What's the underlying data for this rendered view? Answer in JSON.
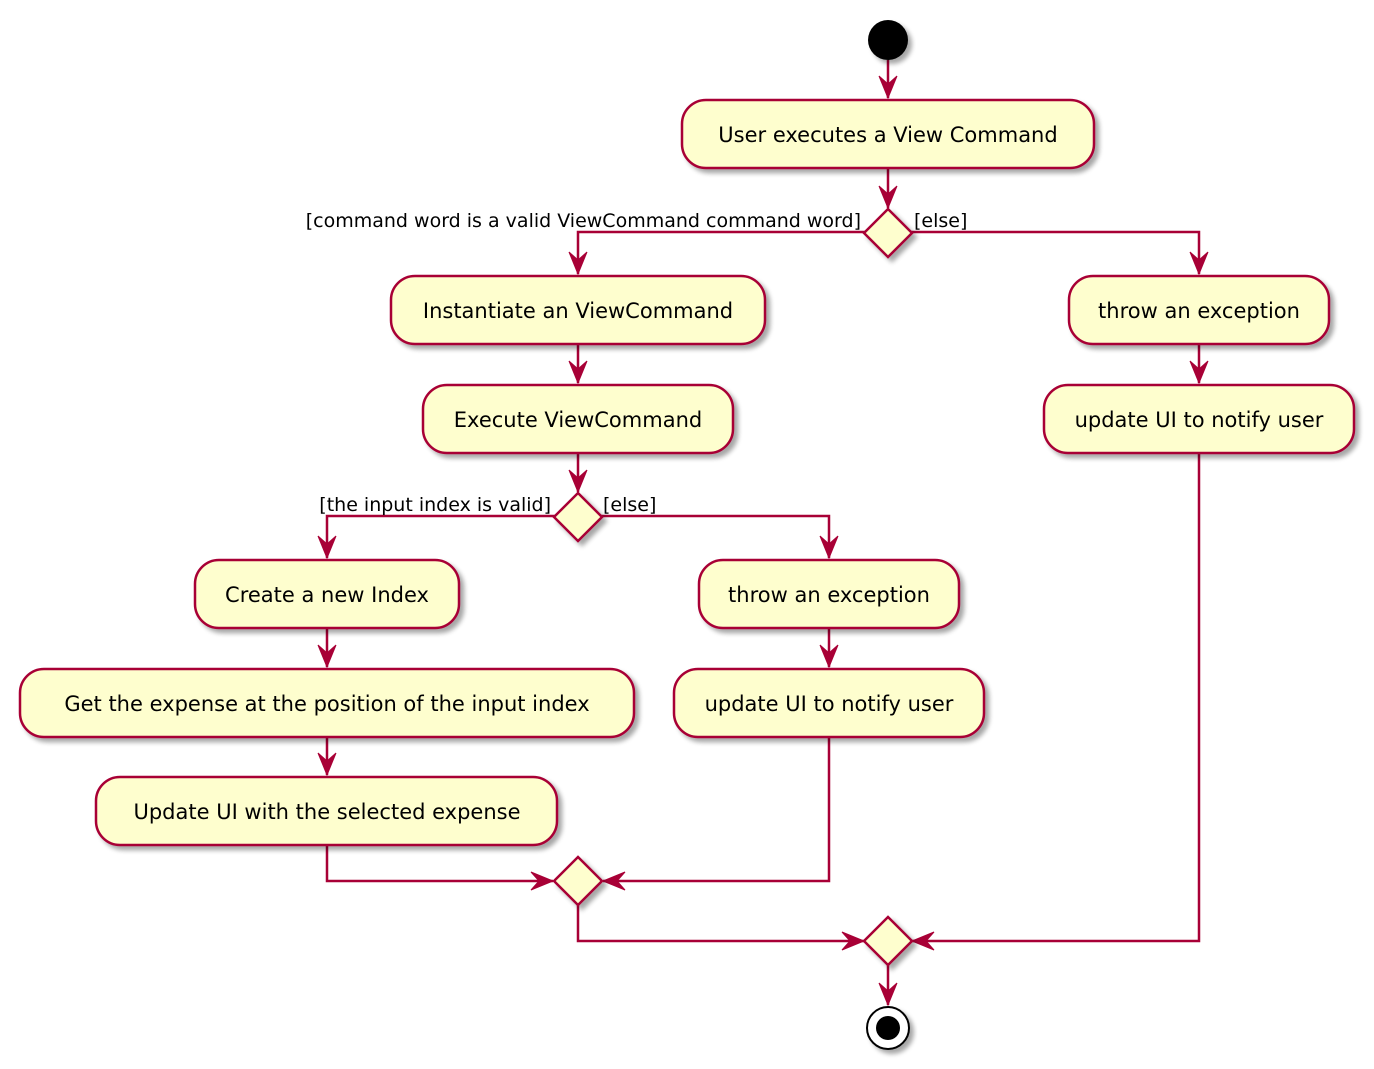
{
  "diagram": {
    "type": "activity",
    "colors": {
      "border": "#A80036",
      "fill": "#FEFECE",
      "start": "#000000"
    },
    "activities": {
      "user_executes": "User executes a View Command",
      "instantiate": "Instantiate an ViewCommand",
      "execute": "Execute ViewCommand",
      "throw_1": "throw an exception",
      "notify_1": "update UI to notify user",
      "create_index": "Create a new Index",
      "get_expense": "Get the expense at the position of the input index",
      "update_ui": "Update UI with the selected expense",
      "throw_2": "throw an exception",
      "notify_2": "update UI to notify user"
    },
    "guards": {
      "valid_command": "[command word is a valid ViewCommand command word]",
      "else_1": "[else]",
      "valid_index": "[the input index is valid]",
      "else_2": "[else]"
    }
  }
}
